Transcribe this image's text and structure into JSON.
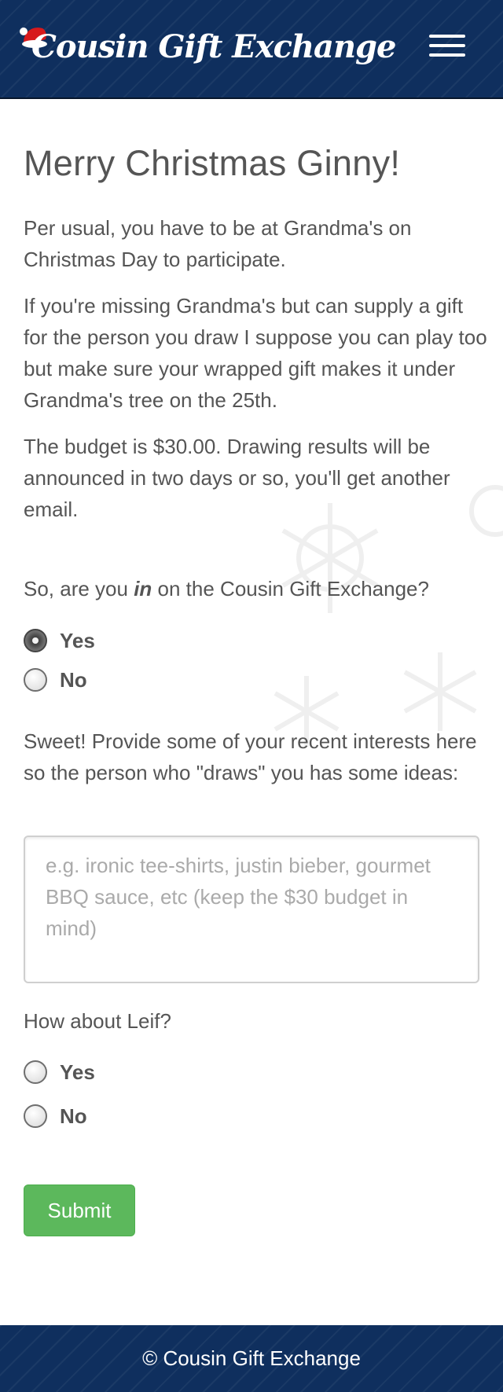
{
  "navbar": {
    "brand": "Cousin Gift Exchange",
    "menu_icon": "hamburger-icon",
    "hat_icon": "santa-hat-icon"
  },
  "main": {
    "heading": "Merry Christmas Ginny!",
    "para1": "Per usual, you have to be at Grandma's on Christmas Day to participate.",
    "para2": "If you're missing Grandma's but can supply a gift for the person you draw I suppose you can play too but make sure your wrapped gift makes it under Grandma's tree on the 25th.",
    "para3": "The budget is $30.00. Drawing results will be announced in two days or so, you'll get another email.",
    "question1": {
      "before": "So, are you ",
      "emphasis": "in",
      "after": " on the Cousin Gift Exchange?"
    },
    "options1": [
      {
        "label": "Yes",
        "checked": true
      },
      {
        "label": "No",
        "checked": false
      }
    ],
    "interests_prompt": "Sweet! Provide some of your recent interests here so the person who \"draws\" you has some ideas:",
    "interests_placeholder": "e.g. ironic tee-shirts, justin bieber, gourmet BBQ sauce, etc (keep the $30 budget in mind)",
    "question2": "How about Leif?",
    "options2": [
      {
        "label": "Yes",
        "checked": false
      },
      {
        "label": "No",
        "checked": false
      }
    ],
    "submit_label": "Submit"
  },
  "footer": {
    "text": "© Cousin Gift Exchange"
  },
  "colors": {
    "navbar_bg": "#0f2f5e",
    "submit_bg": "#5cb85c",
    "text": "#555555"
  }
}
